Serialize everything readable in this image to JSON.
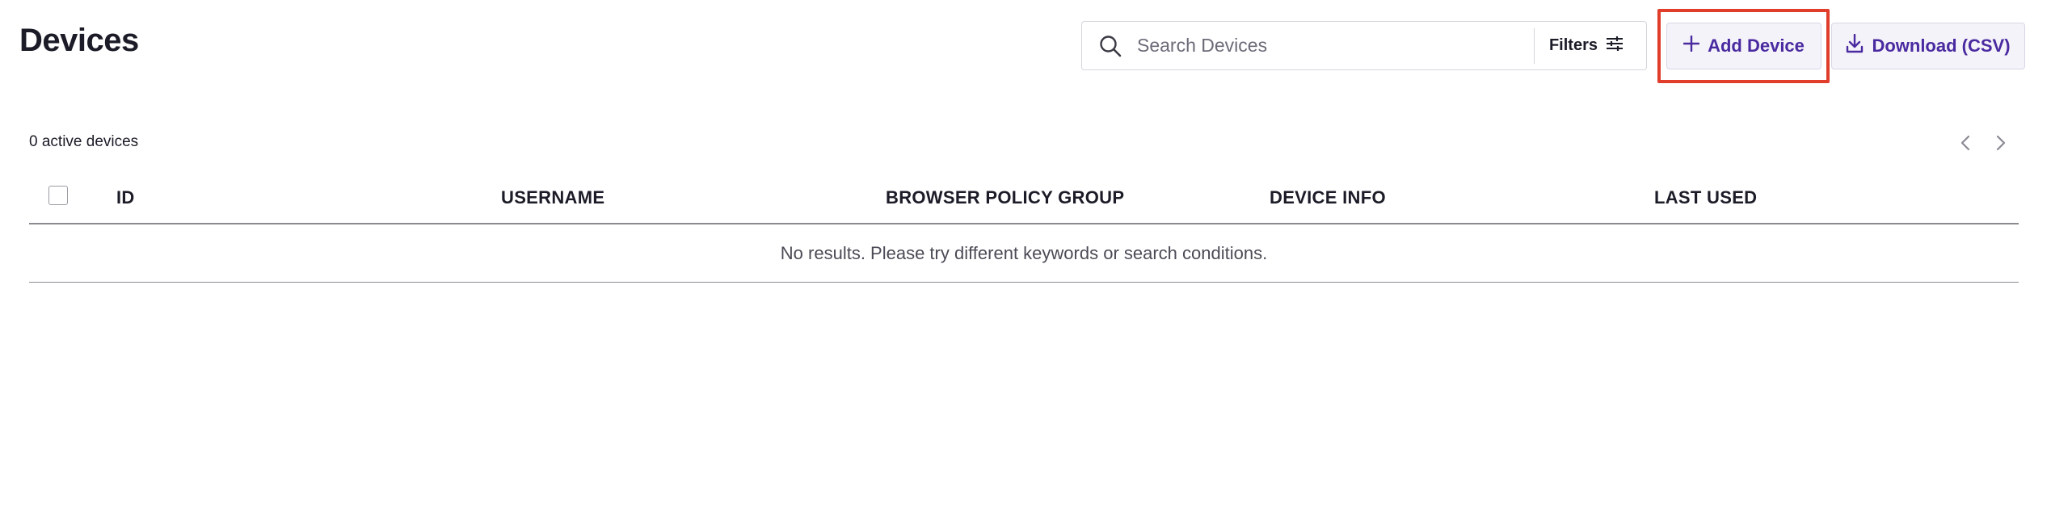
{
  "page": {
    "title": "Devices"
  },
  "search": {
    "placeholder": "Search Devices",
    "filters_label": "Filters"
  },
  "actions": {
    "add_device_label": "Add Device",
    "download_label": "Download (CSV)"
  },
  "summary": {
    "active_count_text": "0 active devices"
  },
  "table": {
    "columns": [
      "ID",
      "USERNAME",
      "BROWSER POLICY GROUP",
      "DEVICE INFO",
      "LAST USED"
    ],
    "rows": [],
    "empty_message": "No results. Please try different keywords or search conditions."
  },
  "colors": {
    "accent": "#4a2aa0",
    "highlight": "#e03d2b",
    "button_bg": "#f4f3f9",
    "border": "#d4d4dc"
  },
  "icons": {
    "search": "search-icon",
    "filters": "sliders-icon",
    "add": "plus-icon",
    "download": "download-icon",
    "prev": "chevron-left-icon",
    "next": "chevron-right-icon"
  }
}
